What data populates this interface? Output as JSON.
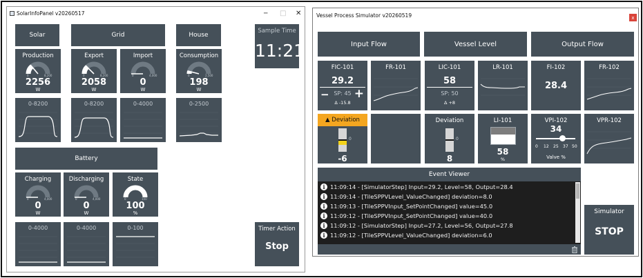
{
  "solar_panel": {
    "title": "SolarInfoPanel v20260517",
    "minimize": "─",
    "maximize": "□",
    "close": "✕",
    "groups": {
      "solar": "Solar",
      "grid": "Grid",
      "house": "House",
      "battery": "Battery"
    },
    "sample_time": {
      "label": "Sample Time",
      "value": "11:21"
    },
    "production": {
      "label": "Production",
      "value": "2256",
      "unit": "W",
      "min": "0",
      "max": "8,200",
      "level": 0.275,
      "range": "0-8200"
    },
    "export": {
      "label": "Export",
      "value": "2058",
      "unit": "W",
      "min": "0",
      "max": "8,200",
      "level": 0.25,
      "range": "0-8200"
    },
    "import": {
      "label": "Import",
      "value": "0",
      "unit": "W",
      "min": "0",
      "max": "4,000",
      "level": 0,
      "range": "0-4000"
    },
    "consumption": {
      "label": "Consumption",
      "value": "198",
      "unit": "W",
      "min": "0",
      "max": "2,500",
      "level": 0.08,
      "range": "0-2500"
    },
    "charging": {
      "label": "Charging",
      "value": "0",
      "unit": "W",
      "min": "0",
      "max": "4,000",
      "level": 0,
      "range": "0-4000"
    },
    "discharging": {
      "label": "Discharging",
      "value": "0",
      "unit": "W",
      "min": "0",
      "max": "4,000",
      "level": 0,
      "range": "0-4000"
    },
    "state": {
      "label": "State",
      "value": "100",
      "unit": "%",
      "min": "0",
      "max": "100",
      "level": 1.0,
      "range": "0-100"
    },
    "timer_action": {
      "label": "Timer Action",
      "button": "Stop"
    }
  },
  "vessel_panel": {
    "title": "Vessel Process Simulator v20260519",
    "close": "x",
    "sections": {
      "input": "Input Flow",
      "level": "Vessel Level",
      "output": "Output Flow"
    },
    "fic101": {
      "label": "FIC-101",
      "value": "29.2",
      "sp": "SP: 45",
      "delta": "Δ -15.8",
      "minus": "−",
      "plus": "+"
    },
    "fr101": {
      "label": "FR-101"
    },
    "lic101": {
      "label": "LIC-101",
      "value": "58",
      "sp": "SP: 50",
      "delta": "Δ +8"
    },
    "lr101": {
      "label": "LR-101"
    },
    "fi102": {
      "label": "FI-102",
      "value": "28.4"
    },
    "fr102": {
      "label": "FR-102"
    },
    "deviation1": {
      "label": "▲ Deviation",
      "zero": "0",
      "value": "-6",
      "level": -6
    },
    "deviation2": {
      "label": "Deviation",
      "zero": "0",
      "value": "8",
      "level": 8
    },
    "li101": {
      "label": "LI-101",
      "value": "58",
      "unit": "%",
      "level": 0.58
    },
    "vpi102": {
      "label": "VPI-102",
      "value": "34",
      "ticks": [
        "0",
        "12",
        "25",
        "37",
        "50"
      ],
      "caption": "Valve %",
      "level": 34
    },
    "vpr102": {
      "label": "VPR-102"
    },
    "event_viewer": {
      "title": "Event Viewer",
      "events": [
        "11:09:14 - [SimulatorStep] Input=29.2, Level=58, Output=28.4",
        "11:09:14 - [TileSPPVLevel_ValueChanged] deviation=8.0",
        "11:09:13 - [TileSPPVInput_SetPointChanged] value=45.0",
        "11:09:12 - [TileSPPVInput_SetPointChanged] value=40.0",
        "11:09:12 - [SimulatorStep] Input=27.2, Level=56, Output=27.8",
        "11:09:12 - [TileSPPVLevel_ValueChanged] deviation=6.0"
      ]
    },
    "simulator": {
      "label": "Simulator",
      "button": "STOP"
    }
  },
  "colors": {
    "tile": "#455059",
    "tile_dark": "#3b444c",
    "accent_orange": "#f4a620",
    "yellow": "#f2d21a",
    "event_bg": "#1e1e1e",
    "close_red": "#d9443a"
  }
}
